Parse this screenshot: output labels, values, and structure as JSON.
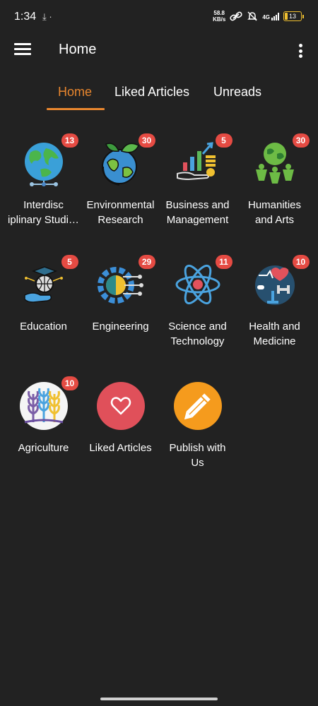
{
  "status_bar": {
    "time": "1:34",
    "net_speed_value": "58.8",
    "net_speed_unit": "KB/s",
    "network": "4G",
    "battery": "13"
  },
  "app_bar": {
    "title": "Home"
  },
  "tabs": [
    {
      "label": "Home",
      "active": true
    },
    {
      "label": "Liked Articles",
      "active": false
    },
    {
      "label": "Unreads",
      "active": false
    }
  ],
  "categories": [
    {
      "line1": "Interdisc",
      "line2": "iplinary Studi…",
      "badge": "13"
    },
    {
      "line1": "Environmental",
      "line2": "Research",
      "badge": "30"
    },
    {
      "line1": "Business and",
      "line2": "Management",
      "badge": "5"
    },
    {
      "line1": "Humanities",
      "line2": "and Arts",
      "badge": "30"
    },
    {
      "line1": "Education",
      "line2": "",
      "badge": "5"
    },
    {
      "line1": "Engineering",
      "line2": "",
      "badge": "29"
    },
    {
      "line1": "Science and",
      "line2": "Technology",
      "badge": "11"
    },
    {
      "line1": "Health and",
      "line2": "Medicine",
      "badge": "10"
    },
    {
      "line1": "Agriculture",
      "line2": "",
      "badge": "10"
    },
    {
      "line1": "Liked Articles",
      "line2": "",
      "badge": ""
    },
    {
      "line1": "Publish with",
      "line2": "Us",
      "badge": ""
    }
  ],
  "colors": {
    "background": "#222222",
    "accent": "#e8862e",
    "badge": "#e54b43",
    "liked_circle": "#e0505a",
    "publish_circle": "#f59b1d"
  }
}
